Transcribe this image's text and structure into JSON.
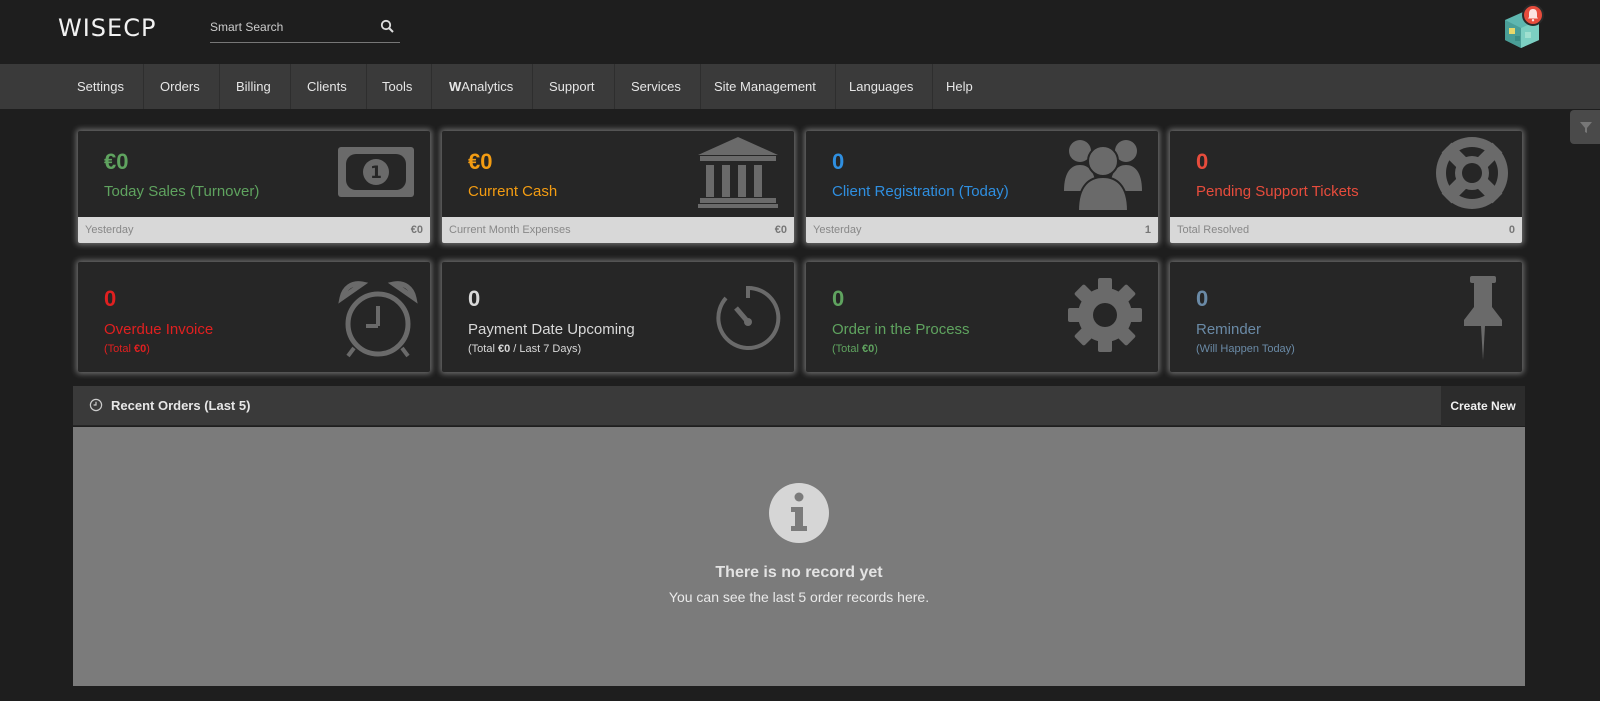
{
  "header": {
    "logo": "WISECP",
    "search_placeholder": "Smart Search"
  },
  "nav": [
    {
      "label": "Settings"
    },
    {
      "label": "Orders"
    },
    {
      "label": "Billing"
    },
    {
      "label": "Clients"
    },
    {
      "label": "Tools"
    },
    {
      "label_bold": "W",
      "label": "Analytics"
    },
    {
      "label": "Support"
    },
    {
      "label": "Services"
    },
    {
      "label": "Site Management"
    },
    {
      "label": "Languages"
    },
    {
      "label": "Help"
    }
  ],
  "cards_row1": [
    {
      "value": "€0",
      "label": "Today Sales (Turnover)",
      "foot_left": "Yesterday",
      "foot_right": "€0",
      "color": "#5fa35f",
      "icon": "money-bill-icon"
    },
    {
      "value": "€0",
      "label": "Current Cash",
      "foot_left": "Current Month Expenses",
      "foot_right": "€0",
      "color": "#f39c12",
      "icon": "bank-icon"
    },
    {
      "value": "0",
      "label": "Client Registration (Today)",
      "foot_left": "Yesterday",
      "foot_right": "1",
      "color": "#2f8fe0",
      "icon": "users-icon"
    },
    {
      "value": "0",
      "label": "Pending Support Tickets",
      "foot_left": "Total Resolved",
      "foot_right": "0",
      "color": "#e74c3c",
      "icon": "lifebuoy-icon"
    }
  ],
  "cards_row2": [
    {
      "value": "0",
      "label": "Overdue Invoice",
      "sub_prefix": "(Total ",
      "sub_value": "€0",
      "sub_suffix": ")",
      "color": "#e02020",
      "icon": "alarm-clock-icon"
    },
    {
      "value": "0",
      "label": "Payment Date Upcoming",
      "sub_prefix": "(Total ",
      "sub_value": "€0",
      "sub_suffix": " / Last 7 Days)",
      "color": "#d8d8d8",
      "icon": "stopwatch-icon"
    },
    {
      "value": "0",
      "label": "Order in the Process",
      "sub_prefix": "(Total ",
      "sub_value": "€0",
      "sub_suffix": ")",
      "color": "#5fa35f",
      "icon": "gear-icon"
    },
    {
      "value": "0",
      "label": "Reminder",
      "sub_prefix": "(Will Happen Today)",
      "sub_value": "",
      "sub_suffix": "",
      "color": "#6a8aa6",
      "icon": "pushpin-icon"
    }
  ],
  "recent_orders": {
    "title": "Recent Orders (Last 5)",
    "create_label": "Create New",
    "empty_title": "There is no record yet",
    "empty_desc": "You can see the last 5 order records here."
  }
}
